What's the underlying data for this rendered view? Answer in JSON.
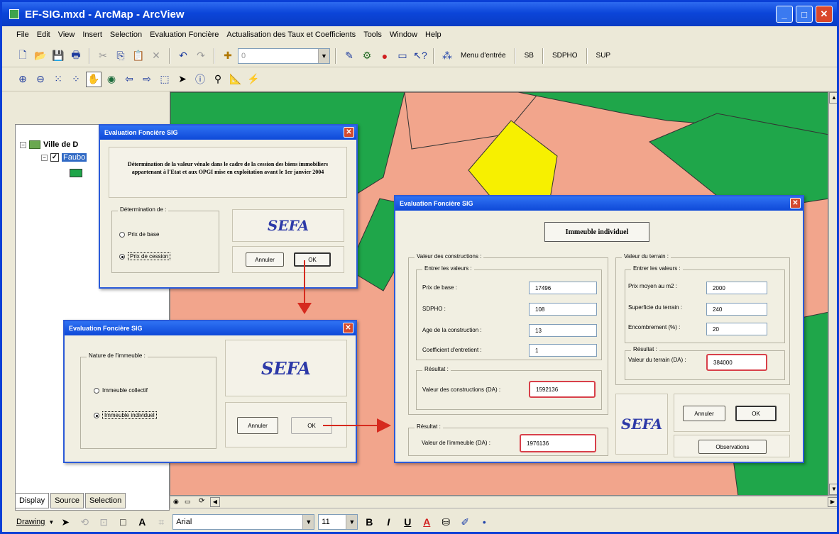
{
  "window": {
    "title": "EF-SIG.mxd - ArcMap - ArcView"
  },
  "menu": [
    "File",
    "Edit",
    "View",
    "Insert",
    "Selection",
    "Evaluation Foncière",
    "Actualisation des Taux et Coefficients",
    "Tools",
    "Window",
    "Help"
  ],
  "toolbar": {
    "scale_value": "0",
    "menu_entree": "Menu d'entrée",
    "sb": "SB",
    "sdpho": "SDPHO",
    "sup": "SUP"
  },
  "toc": {
    "root_label": "Ville de D",
    "layer_label": "Faubo"
  },
  "tabs": [
    "Display",
    "Source",
    "Selection"
  ],
  "drawing": {
    "label": "Drawing",
    "font": "Arial",
    "size": "11"
  },
  "dialog1": {
    "title": "Evaluation Foncière SIG",
    "heading": "Détermination de la valeur vénale dans le cadre de la cession des biens immobiliers appartenant à l'Etat et aux OPGI mise en exploitation avant le 1er janvier 2004",
    "group_label": "Détermination de :",
    "radio1": "Prix de base",
    "radio2": "Prix de cession",
    "logo": "SEFA",
    "cancel": "Annuler",
    "ok": "OK"
  },
  "dialog2": {
    "title": "Evaluation Foncière SIG",
    "group_label": "Nature de l'immeuble :",
    "radio1": "Immeuble collectif",
    "radio2": "Immeuble individuel",
    "logo": "SEFA",
    "cancel": "Annuler",
    "ok": "OK"
  },
  "dialog3": {
    "title": "Evaluation Foncière SIG",
    "heading": "Immeuble individuel",
    "constructions": {
      "group": "Valeur des constructions :",
      "sub": "Entrer les valeurs :",
      "fields": [
        {
          "label": "Prix de base :",
          "value": "17496"
        },
        {
          "label": "SDPHO :",
          "value": "108"
        },
        {
          "label": "Age de la construction :",
          "value": "13"
        },
        {
          "label": "Coefficient d'entretient :",
          "value": "1"
        }
      ],
      "result_group": "Résultat :",
      "result_label": "Valeur des constructions (DA) :",
      "result_value": "1592136"
    },
    "terrain": {
      "group": "Valeur du terrain :",
      "sub": "Entrer les valeurs :",
      "fields": [
        {
          "label": "Prix moyen au m2 :",
          "value": "2000"
        },
        {
          "label": "Superficie du terrain :",
          "value": "240"
        },
        {
          "label": "Encombrement (%) :",
          "value": "20"
        }
      ],
      "result_group": "Résultat :",
      "result_label": "Valeur du terrain (DA) :",
      "result_value": "384000"
    },
    "immeuble": {
      "group": "Résultat :",
      "label": "Valeur de l'immeuble (DA) :",
      "value": "1976136"
    },
    "logo": "SEFA",
    "cancel": "Annuler",
    "ok": "OK",
    "observations": "Observations"
  },
  "colors": {
    "map_bg": "#f2a58c",
    "green": "#1fa64a",
    "yellow": "#f7f000",
    "arrow": "#d62a1e",
    "titlebar": "#0b45d9"
  }
}
